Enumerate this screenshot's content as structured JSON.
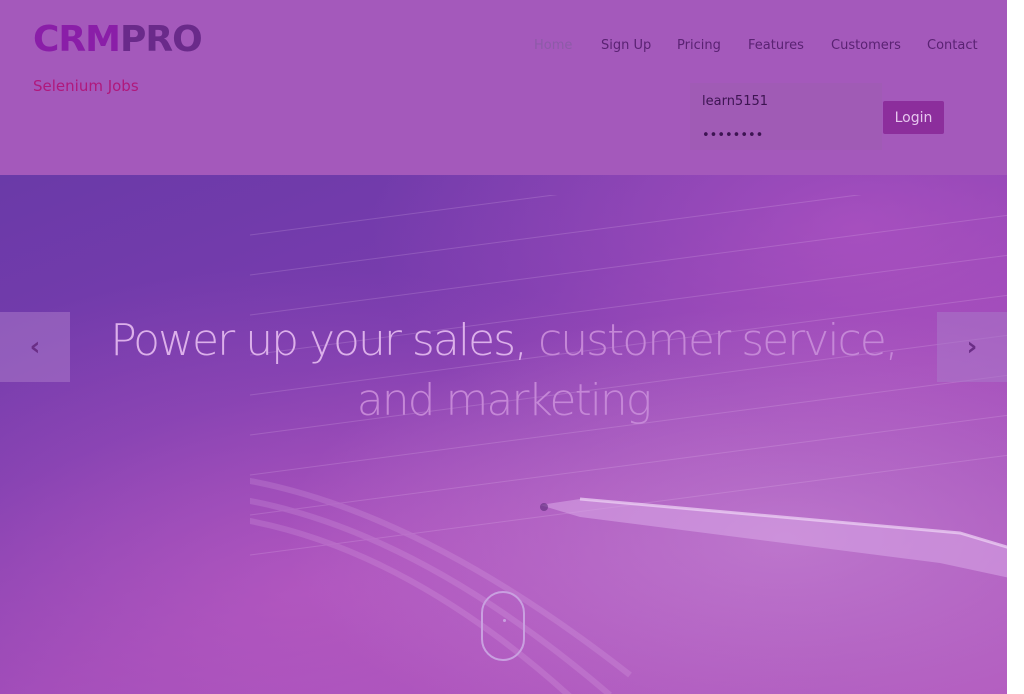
{
  "brand": {
    "logo_part1": "CRM",
    "logo_part2": "PRO",
    "tagline": "Selenium Jobs"
  },
  "nav": {
    "items": [
      {
        "label": "Home",
        "active": true
      },
      {
        "label": "Sign Up"
      },
      {
        "label": "Pricing"
      },
      {
        "label": "Features"
      },
      {
        "label": "Customers"
      },
      {
        "label": "Contact"
      }
    ]
  },
  "login": {
    "username_value": "learn5151",
    "password_value": "••••••••",
    "button_label": "Login"
  },
  "hero": {
    "headline_part1": "Power up your sales,",
    "headline_part2": " customer service, and marketing",
    "prev_icon": "chevron-left-icon",
    "next_icon": "chevron-right-icon",
    "scroll_icon": "mouse-scroll-icon"
  },
  "colors": {
    "header_bg": "#a459bb",
    "logo_crm": "#8a1ea8",
    "logo_pro": "#6a2a8a",
    "tagline": "#b0187c",
    "login_button": "#8c2e9c"
  }
}
